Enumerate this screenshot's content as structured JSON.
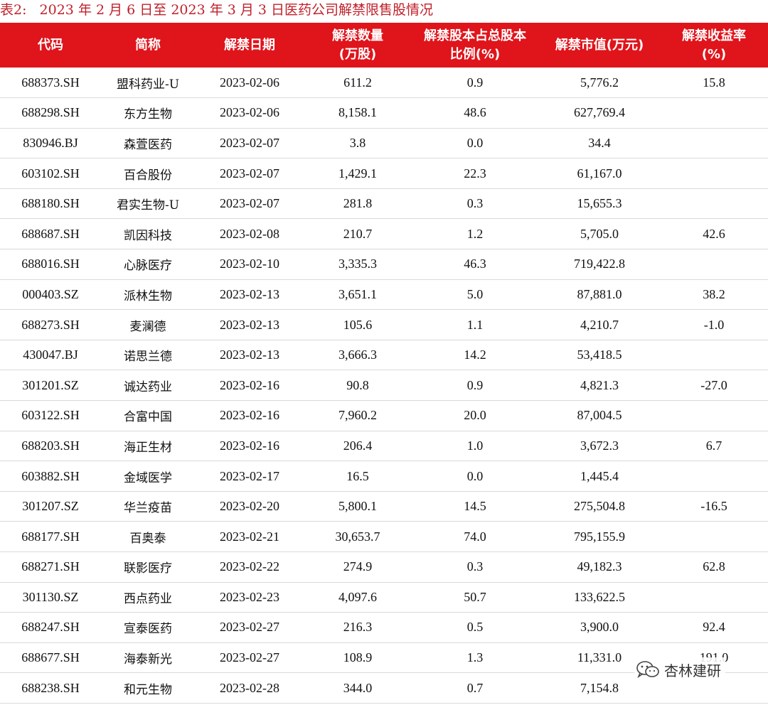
{
  "title": {
    "label": "表2:",
    "text": "2023 年 2 月 6 日至 2023 年 3 月 3 日医药公司解禁限售股情况"
  },
  "columns": [
    "代码",
    "简称",
    "解禁日期",
    "解禁数量\n(万股)",
    "解禁股本占总股本\n比例(%)",
    "解禁市值(万元)",
    "解禁收益率\n(%)"
  ],
  "rows": [
    [
      "688373.SH",
      "盟科药业-U",
      "2023-02-06",
      "611.2",
      "0.9",
      "5,776.2",
      "15.8"
    ],
    [
      "688298.SH",
      "东方生物",
      "2023-02-06",
      "8,158.1",
      "48.6",
      "627,769.4",
      ""
    ],
    [
      "830946.BJ",
      "森萱医药",
      "2023-02-07",
      "3.8",
      "0.0",
      "34.4",
      ""
    ],
    [
      "603102.SH",
      "百合股份",
      "2023-02-07",
      "1,429.1",
      "22.3",
      "61,167.0",
      ""
    ],
    [
      "688180.SH",
      "君实生物-U",
      "2023-02-07",
      "281.8",
      "0.3",
      "15,655.3",
      ""
    ],
    [
      "688687.SH",
      "凯因科技",
      "2023-02-08",
      "210.7",
      "1.2",
      "5,705.0",
      "42.6"
    ],
    [
      "688016.SH",
      "心脉医疗",
      "2023-02-10",
      "3,335.3",
      "46.3",
      "719,422.8",
      ""
    ],
    [
      "000403.SZ",
      "派林生物",
      "2023-02-13",
      "3,651.1",
      "5.0",
      "87,881.0",
      "38.2"
    ],
    [
      "688273.SH",
      "麦澜德",
      "2023-02-13",
      "105.6",
      "1.1",
      "4,210.7",
      "-1.0"
    ],
    [
      "430047.BJ",
      "诺思兰德",
      "2023-02-13",
      "3,666.3",
      "14.2",
      "53,418.5",
      ""
    ],
    [
      "301201.SZ",
      "诚达药业",
      "2023-02-16",
      "90.8",
      "0.9",
      "4,821.3",
      "-27.0"
    ],
    [
      "603122.SH",
      "合富中国",
      "2023-02-16",
      "7,960.2",
      "20.0",
      "87,004.5",
      ""
    ],
    [
      "688203.SH",
      "海正生材",
      "2023-02-16",
      "206.4",
      "1.0",
      "3,672.3",
      "6.7"
    ],
    [
      "603882.SH",
      "金域医学",
      "2023-02-17",
      "16.5",
      "0.0",
      "1,445.4",
      ""
    ],
    [
      "301207.SZ",
      "华兰疫苗",
      "2023-02-20",
      "5,800.1",
      "14.5",
      "275,504.8",
      "-16.5"
    ],
    [
      "688177.SH",
      "百奥泰",
      "2023-02-21",
      "30,653.7",
      "74.0",
      "795,155.9",
      ""
    ],
    [
      "688271.SH",
      "联影医疗",
      "2023-02-22",
      "274.9",
      "0.3",
      "49,182.3",
      "62.8"
    ],
    [
      "301130.SZ",
      "西点药业",
      "2023-02-23",
      "4,097.6",
      "50.7",
      "133,622.5",
      ""
    ],
    [
      "688247.SH",
      "宣泰医药",
      "2023-02-27",
      "216.3",
      "0.5",
      "3,900.0",
      "92.4"
    ],
    [
      "688677.SH",
      "海泰新光",
      "2023-02-27",
      "108.9",
      "1.3",
      "11,331.0",
      "191.0"
    ],
    [
      "688238.SH",
      "和元生物",
      "2023-02-28",
      "344.0",
      "0.7",
      "7,154.8",
      ""
    ]
  ],
  "watermark": {
    "text": "杏林建研",
    "icon": "wechat-icon"
  },
  "colors": {
    "header_bg": "#e0141b",
    "title": "#c0202a"
  }
}
